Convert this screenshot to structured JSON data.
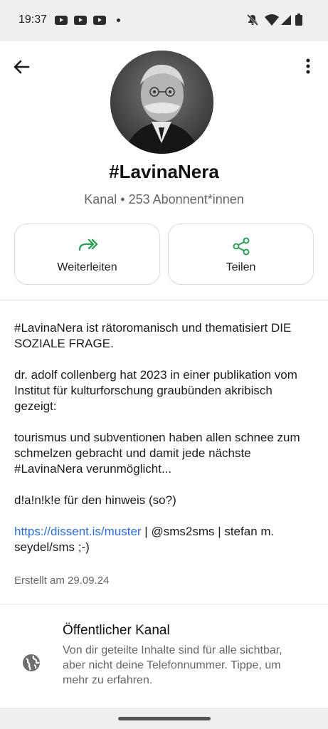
{
  "status_bar": {
    "time": "19:37",
    "notification_icons": [
      "youtube-icon",
      "youtube-icon",
      "youtube-icon",
      "dot-icon"
    ],
    "system_icons": [
      "mute-icon",
      "wifi-icon",
      "signal-icon",
      "battery-icon"
    ]
  },
  "header": {
    "back_icon": "arrow-left-icon",
    "menu_icon": "more-vertical-icon"
  },
  "channel": {
    "name": "#LavinaNera",
    "subtitle": "Kanal • 253 Abonnent*innen"
  },
  "actions": [
    {
      "label": "Weiterleiten",
      "icon": "forward-icon"
    },
    {
      "label": "Teilen",
      "icon": "share-icon"
    }
  ],
  "description": {
    "p1": "#LavinaNera ist rätoromanisch und thematisiert DIE SOZIALE FRAGE.",
    "p2": "dr. adolf collenberg hat 2023 in einer publikation vom Institut für kulturforschung graubünden akribisch gezeigt:",
    "p3": "tourismus und subventionen haben allen schnee zum schmelzen gebracht und damit jede nächste #LavinaNera verunmöglicht...",
    "p4": "d!a!n!k!e für den hinweis (so?)",
    "link": "https://dissent.is/muster",
    "p5_rest": " | @sms2sms | stefan m. seydel/sms ;-)"
  },
  "created": "Erstellt am 29.09.24",
  "public_channel": {
    "title": "Öffentlicher Kanal",
    "text": "Von dir geteilte Inhalte sind für alle sichtbar, aber nicht deine Telefonnummer. Tippe, um mehr zu erfahren.",
    "icon": "globe-icon"
  },
  "colors": {
    "accent_green": "#2e9e57",
    "link_blue": "#2f6fd2"
  }
}
